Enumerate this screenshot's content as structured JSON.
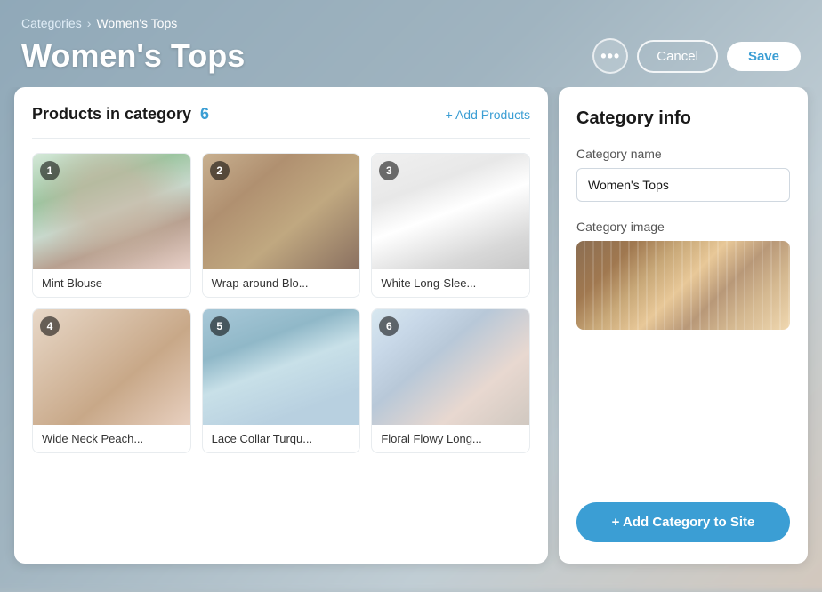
{
  "breadcrumb": {
    "parent_label": "Categories",
    "separator": "›",
    "current_label": "Women's Tops"
  },
  "page": {
    "title": "Women's Tops"
  },
  "header": {
    "more_icon": "•••",
    "cancel_label": "Cancel",
    "save_label": "Save"
  },
  "products_panel": {
    "title": "Products in category",
    "count": "6",
    "add_link": "+ Add Products",
    "products": [
      {
        "id": 1,
        "number": "1",
        "label": "Mint Blouse",
        "img_class": "img-mint-blouse"
      },
      {
        "id": 2,
        "number": "2",
        "label": "Wrap-around Blo...",
        "img_class": "img-wrap-around"
      },
      {
        "id": 3,
        "number": "3",
        "label": "White Long-Slee...",
        "img_class": "img-white-long"
      },
      {
        "id": 4,
        "number": "4",
        "label": "Wide Neck Peach...",
        "img_class": "img-wide-neck"
      },
      {
        "id": 5,
        "number": "5",
        "label": "Lace Collar Turqu...",
        "img_class": "img-lace-collar"
      },
      {
        "id": 6,
        "number": "6",
        "label": "Floral Flowy Long...",
        "img_class": "img-floral-flowy"
      }
    ]
  },
  "category_panel": {
    "title": "Category info",
    "name_label": "Category name",
    "name_value": "Women's Tops",
    "image_label": "Category image",
    "add_button_label": "+ Add Category to Site"
  }
}
